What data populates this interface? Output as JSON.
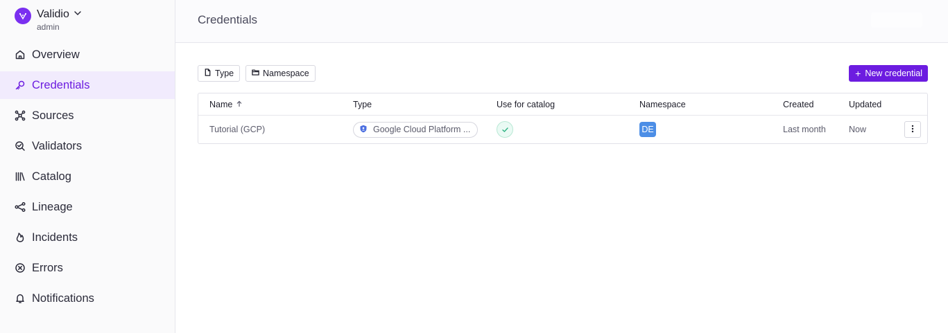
{
  "workspace": {
    "name": "Validio",
    "role": "admin"
  },
  "nav": {
    "items": [
      {
        "label": "Overview",
        "icon": "home-icon"
      },
      {
        "label": "Credentials",
        "icon": "key-icon",
        "active": true
      },
      {
        "label": "Sources",
        "icon": "sources-icon"
      },
      {
        "label": "Validators",
        "icon": "validators-icon"
      },
      {
        "label": "Catalog",
        "icon": "catalog-icon"
      },
      {
        "label": "Lineage",
        "icon": "lineage-icon"
      },
      {
        "label": "Incidents",
        "icon": "flame-icon"
      },
      {
        "label": "Errors",
        "icon": "x-circle-icon"
      },
      {
        "label": "Notifications",
        "icon": "bell-icon"
      }
    ]
  },
  "header": {
    "title": "Credentials"
  },
  "toolbar": {
    "filter_type": "Type",
    "filter_namespace": "Namespace",
    "new_label": "New credential"
  },
  "table": {
    "columns": [
      "Name",
      "Type",
      "Use for catalog",
      "Namespace",
      "Created",
      "Updated"
    ],
    "rows": [
      {
        "name": "Tutorial (GCP)",
        "type": "Google Cloud Platform ...",
        "use_for_catalog": true,
        "namespace": "DE",
        "created": "Last month",
        "updated": "Now"
      }
    ]
  },
  "colors": {
    "accent": "#6c1ce0",
    "active_bg": "#f1ebfd",
    "namespace_badge": "#4c8ee6",
    "catalog_check": "#2fb383"
  }
}
